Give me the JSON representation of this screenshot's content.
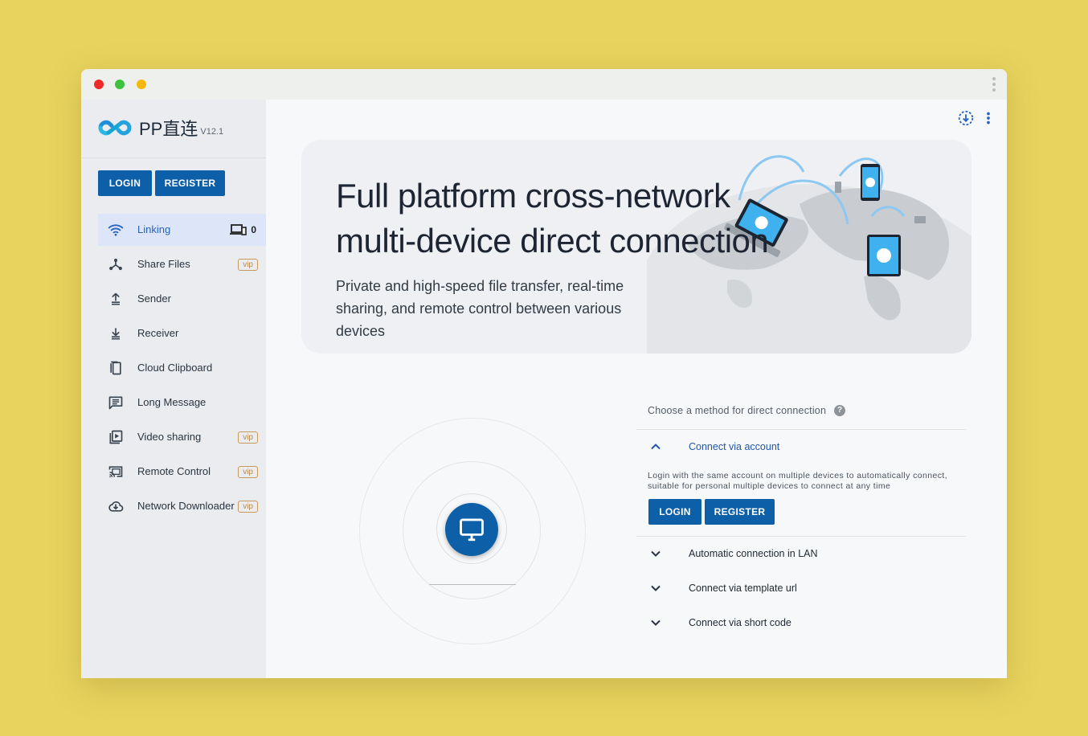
{
  "window": {
    "brand_name": "PP直连",
    "brand_version": "V12.1"
  },
  "sidebar": {
    "login_label": "LOGIN",
    "register_label": "REGISTER",
    "items": [
      {
        "label": "Linking",
        "icon": "wifi-icon",
        "active": true,
        "device_count": "0"
      },
      {
        "label": "Share Files",
        "icon": "share-icon",
        "vip": "vip"
      },
      {
        "label": "Sender",
        "icon": "upload-icon"
      },
      {
        "label": "Receiver",
        "icon": "download-icon"
      },
      {
        "label": "Cloud Clipboard",
        "icon": "clipboard-icon"
      },
      {
        "label": "Long Message",
        "icon": "message-icon"
      },
      {
        "label": "Video sharing",
        "icon": "video-icon",
        "vip": "vip"
      },
      {
        "label": "Remote Control",
        "icon": "cast-icon",
        "vip": "vip"
      },
      {
        "label": "Network Downloader",
        "icon": "cloud-download-icon",
        "vip": "vip"
      }
    ]
  },
  "hero": {
    "title_line1": "Full platform cross-network",
    "title_line2": "multi-device direct connection",
    "subtitle": "Private and high-speed file transfer, real-time sharing, and remote control between various devices"
  },
  "connect": {
    "heading": "Choose a method for direct connection",
    "help": "?",
    "methods": [
      {
        "label": "Connect via account",
        "expanded": true,
        "description": "Login with the same account on multiple devices to automatically connect, suitable for personal multiple devices to connect at any time",
        "login_label": "LOGIN",
        "register_label": "REGISTER"
      },
      {
        "label": "Automatic connection in LAN",
        "expanded": false
      },
      {
        "label": "Connect via template url",
        "expanded": false
      },
      {
        "label": "Connect via short code",
        "expanded": false
      }
    ]
  },
  "colors": {
    "background": "#e8d35e",
    "primary": "#0d5fa8",
    "active_nav_bg": "#dde6f8",
    "active_nav_text": "#2762c2",
    "vip_border": "#c89a5a"
  }
}
